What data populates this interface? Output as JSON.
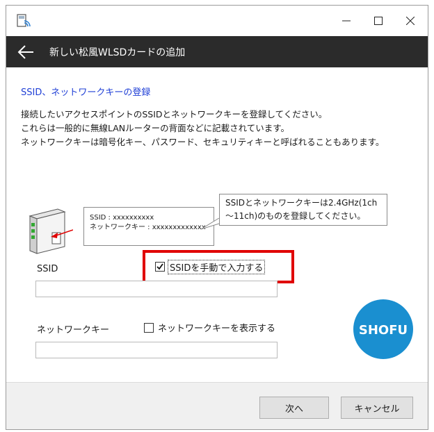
{
  "window": {
    "minimize_glyph": "—",
    "maximize_glyph": "☐",
    "close_glyph": "✕"
  },
  "header": {
    "title": "新しい松風WLSDカードの追加",
    "back_icon": "arrow-left-icon"
  },
  "section": {
    "title": "SSID、ネットワークキーの登録",
    "description": [
      "接続したいアクセスポイントのSSIDとネットワークキーを登録してください。",
      "これらは一般的に無線LANルーターの背面などに記載されています。",
      "ネットワークキーは暗号化キー、パスワード、セキュリティキーと呼ばれることもあります。"
    ]
  },
  "illustration": {
    "label_ssid": "SSID : xxxxxxxxxx",
    "label_key": "ネットワークキー : xxxxxxxxxxxxx",
    "callout_lines": [
      "SSIDとネットワークキーは2.4GHz(1ch",
      "～11ch)のものを登録してください。"
    ]
  },
  "form": {
    "ssid_label": "SSID",
    "manual_entry_label": "SSIDを手動で入力する",
    "manual_entry_checked": true,
    "ssid_value": "",
    "key_label": "ネットワークキー",
    "show_key_label": "ネットワークキーを表示する",
    "show_key_checked": false,
    "key_value": ""
  },
  "logo": {
    "text": "SHOFU",
    "color": "#1a8fd0"
  },
  "footer": {
    "next_label": "次へ",
    "cancel_label": "キャンセル"
  },
  "colors": {
    "header_bg": "#2b2b2b",
    "section_title": "#1f3fd6",
    "highlight": "#e00000",
    "footer_bg": "#f0f0f0"
  }
}
